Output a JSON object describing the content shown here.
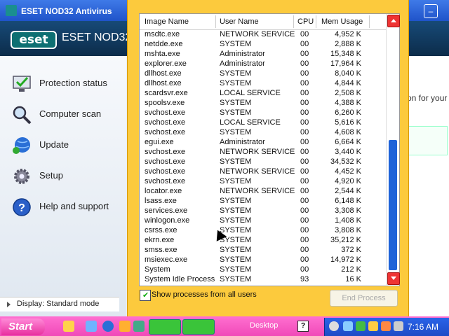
{
  "eset": {
    "window_title": "ESET NOD32 Antivirus",
    "logo": "eset",
    "product": "ESET NOD32",
    "nav": [
      {
        "label": "Protection status",
        "icon": "protection-status-icon"
      },
      {
        "label": "Computer scan",
        "icon": "magnifier-icon"
      },
      {
        "label": "Update",
        "icon": "globe-update-icon"
      },
      {
        "label": "Setup",
        "icon": "gear-icon"
      },
      {
        "label": "Help and support",
        "icon": "help-icon"
      }
    ],
    "display_mode": "Display: Standard mode",
    "right_peek_text": "on for your"
  },
  "taskmgr": {
    "columns": [
      "Image Name",
      "User Name",
      "CPU",
      "Mem Usage"
    ],
    "processes": [
      {
        "image": "msdtc.exe",
        "user": "NETWORK SERVICE",
        "cpu": "00",
        "mem": "4,952 K"
      },
      {
        "image": "netdde.exe",
        "user": "SYSTEM",
        "cpu": "00",
        "mem": "2,888 K"
      },
      {
        "image": "mshta.exe",
        "user": "Administrator",
        "cpu": "00",
        "mem": "15,348 K"
      },
      {
        "image": "explorer.exe",
        "user": "Administrator",
        "cpu": "00",
        "mem": "17,964 K"
      },
      {
        "image": "dllhost.exe",
        "user": "SYSTEM",
        "cpu": "00",
        "mem": "8,040 K"
      },
      {
        "image": "dllhost.exe",
        "user": "SYSTEM",
        "cpu": "00",
        "mem": "4,844 K"
      },
      {
        "image": "scardsvr.exe",
        "user": "LOCAL SERVICE",
        "cpu": "00",
        "mem": "2,508 K"
      },
      {
        "image": "spoolsv.exe",
        "user": "SYSTEM",
        "cpu": "00",
        "mem": "4,388 K"
      },
      {
        "image": "svchost.exe",
        "user": "SYSTEM",
        "cpu": "00",
        "mem": "6,260 K"
      },
      {
        "image": "svchost.exe",
        "user": "LOCAL SERVICE",
        "cpu": "00",
        "mem": "5,616 K"
      },
      {
        "image": "svchost.exe",
        "user": "SYSTEM",
        "cpu": "00",
        "mem": "4,608 K"
      },
      {
        "image": "egui.exe",
        "user": "Administrator",
        "cpu": "00",
        "mem": "6,664 K"
      },
      {
        "image": "svchost.exe",
        "user": "NETWORK SERVICE",
        "cpu": "00",
        "mem": "3,440 K"
      },
      {
        "image": "svchost.exe",
        "user": "SYSTEM",
        "cpu": "00",
        "mem": "34,532 K"
      },
      {
        "image": "svchost.exe",
        "user": "NETWORK SERVICE",
        "cpu": "00",
        "mem": "4,452 K"
      },
      {
        "image": "svchost.exe",
        "user": "SYSTEM",
        "cpu": "00",
        "mem": "4,920 K"
      },
      {
        "image": "locator.exe",
        "user": "NETWORK SERVICE",
        "cpu": "00",
        "mem": "2,544 K"
      },
      {
        "image": "lsass.exe",
        "user": "SYSTEM",
        "cpu": "00",
        "mem": "6,148 K"
      },
      {
        "image": "services.exe",
        "user": "SYSTEM",
        "cpu": "00",
        "mem": "3,308 K"
      },
      {
        "image": "winlogon.exe",
        "user": "SYSTEM",
        "cpu": "00",
        "mem": "1,408 K"
      },
      {
        "image": "csrss.exe",
        "user": "SYSTEM",
        "cpu": "00",
        "mem": "3,808 K"
      },
      {
        "image": "ekrn.exe",
        "user": "SYSTEM",
        "cpu": "00",
        "mem": "35,212 K"
      },
      {
        "image": "smss.exe",
        "user": "SYSTEM",
        "cpu": "00",
        "mem": "372 K"
      },
      {
        "image": "msiexec.exe",
        "user": "SYSTEM",
        "cpu": "00",
        "mem": "14,972 K"
      },
      {
        "image": "System",
        "user": "SYSTEM",
        "cpu": "00",
        "mem": "212 K"
      },
      {
        "image": "System Idle Process",
        "user": "SYSTEM",
        "cpu": "93",
        "mem": "16 K"
      }
    ],
    "show_all_label": "Show processes from all users",
    "show_all_checked": true,
    "end_process_label": "End Process"
  },
  "taskbar": {
    "start_label": "Start",
    "desktop_label": "Desktop",
    "help_glyph": "?",
    "clock": "7:16 AM"
  },
  "colors": {
    "taskmgr_bg": "#fcca3d",
    "scrollbar_thumb": "#1f63d8",
    "scroll_button": "#ee3333",
    "taskbar": "#f04ab8",
    "tray": "#2a63e8"
  }
}
